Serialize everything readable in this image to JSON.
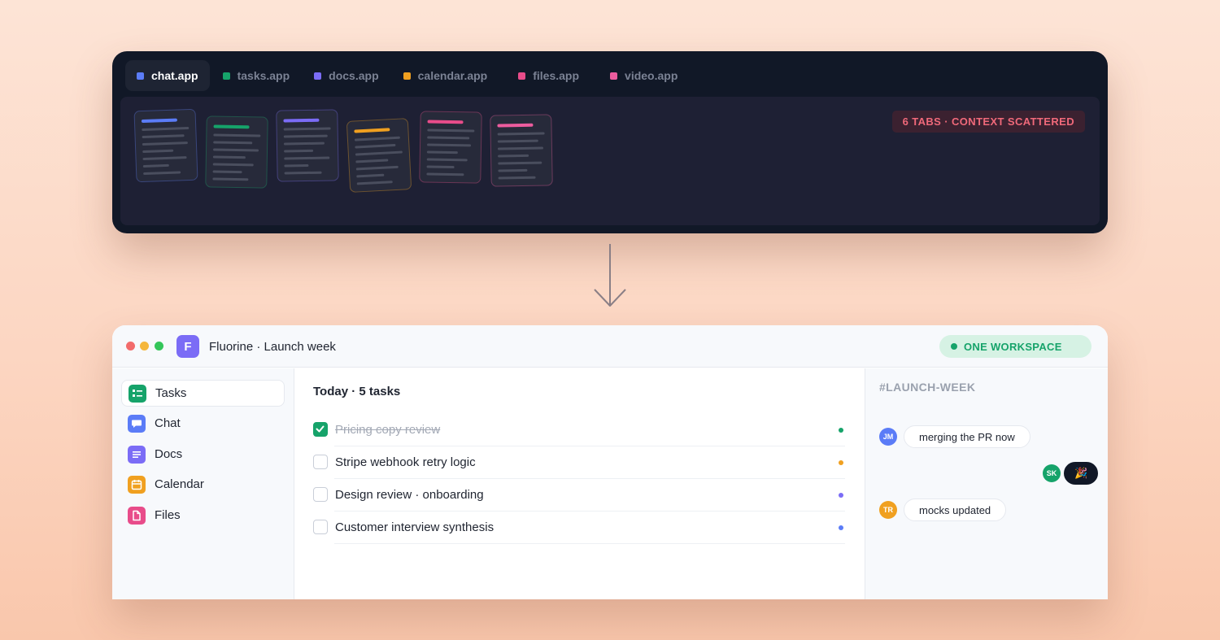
{
  "browser": {
    "tabs": [
      {
        "label": "chat.app",
        "color": "#5b7cf7",
        "active": true
      },
      {
        "label": "tasks.app",
        "color": "#16a36a",
        "active": false
      },
      {
        "label": "docs.app",
        "color": "#7b6cf6",
        "active": false
      },
      {
        "label": "calendar.app",
        "color": "#f0a020",
        "active": false
      },
      {
        "label": "files.app",
        "color": "#e84c8a",
        "active": false
      },
      {
        "label": "video.app",
        "color": "#ec5c9e",
        "active": false
      }
    ],
    "badge": "6 TABS · CONTEXT SCATTERED",
    "doc_cards": [
      {
        "accent": "#5b7cf7"
      },
      {
        "accent": "#16a36a"
      },
      {
        "accent": "#7b6cf6"
      },
      {
        "accent": "#f0a020"
      },
      {
        "accent": "#e84c8a"
      },
      {
        "accent": "#ec5c9e"
      }
    ]
  },
  "workspace": {
    "logo_letter": "F",
    "title": "Fluorine · Launch week",
    "badge": "ONE WORKSPACE",
    "nav": [
      {
        "label": "Tasks",
        "icon": "tasks-icon",
        "color": "#16a36a",
        "active": true
      },
      {
        "label": "Chat",
        "icon": "chat-icon",
        "color": "#5b7cf7",
        "active": false
      },
      {
        "label": "Docs",
        "icon": "docs-icon",
        "color": "#7b6cf6",
        "active": false
      },
      {
        "label": "Calendar",
        "icon": "calendar-icon",
        "color": "#f0a020",
        "active": false
      },
      {
        "label": "Files",
        "icon": "files-icon",
        "color": "#e84c8a",
        "active": false
      }
    ],
    "heading": "Today · 5 tasks",
    "tasks": [
      {
        "label": "Pricing copy review",
        "done": true,
        "color": "#16a36a"
      },
      {
        "label": "Stripe webhook retry logic",
        "done": false,
        "color": "#f0a020"
      },
      {
        "label": "Design review · onboarding",
        "done": false,
        "color": "#7b6cf6"
      },
      {
        "label": "Customer interview synthesis",
        "done": false,
        "color": "#5b7cf7"
      }
    ],
    "channel": "#LAUNCH-WEEK",
    "messages": [
      {
        "initials": "JM",
        "text": "merging the PR now",
        "color": "#5b7cf7"
      },
      {
        "initials": "SK",
        "text": "🎉",
        "color": "#16a36a"
      },
      {
        "initials": "TR",
        "text": "mocks updated",
        "color": "#f0a020"
      }
    ]
  }
}
